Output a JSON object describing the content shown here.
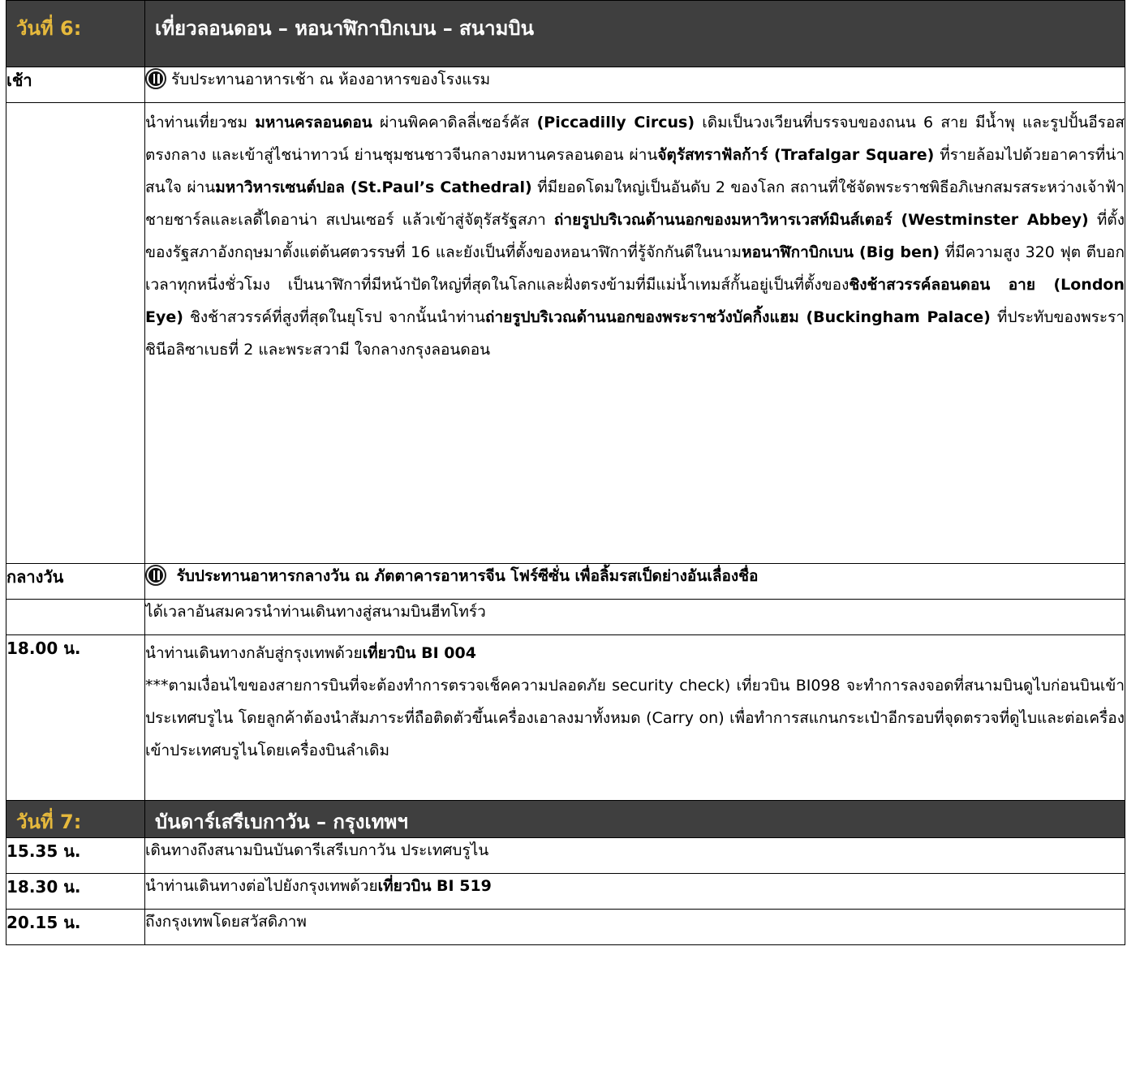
{
  "day6": {
    "label": "วันที่ 6:",
    "title": "เที่ยวลอนดอน – หอนาฬิกาบิกเบน – สนามบิน",
    "breakfast_label": "เช้า",
    "breakfast_text": "รับประทานอาหารเช้า ณ ห้องอาหารของโรงแรม",
    "tour": {
      "p1": "นำท่านเที่ยวชม ",
      "b1": "มหานครลอนดอน",
      "p2": " ผ่านพิคคาดิลลี่เซอร์คัส ",
      "b2": "(Piccadilly Circus)",
      "p3": " เดิมเป็นวงเวียนที่บรรจบของถนน 6 สาย มีน้ำพุ และรูปปั้นอีรอสตรงกลาง และเข้าสู่ไชน่าทาวน์ ย่านชุมชนชาวจีนกลางมหานครลอนดอน ผ่าน",
      "b3": "จัตุรัสทราฟัลก้าร์ (Trafalgar Square)",
      "p4": " ที่รายล้อมไปด้วยอาคารที่น่าสนใจ ผ่าน",
      "b4": "มหาวิหารเซนต์ปอล (St.Paul’s Cathedral)",
      "p5": " ที่มียอดโดมใหญ่เป็นอันดับ 2 ของโลก สถานที่ใช้จัดพระราชพิธีอภิเษกสมรสระหว่างเจ้าฟ้าชายชาร์ลและเลดี้ไดอาน่า สเปนเซอร์ แล้วเข้าสู่จัตุรัสรัฐสภา ",
      "b5": "ถ่ายรูปบริเวณด้านนอกของมหาวิหารเวสท์มินส์เตอร์ (Westminster Abbey)",
      "p6": " ที่ตั้งของรัฐสภาอังกฤษมาตั้งแต่ต้นศตวรรษที่ 16 และยังเป็นที่ตั้งของหอนาฬิกาที่รู้จักกันดีในนาม",
      "b6": "หอนาฬิกาบิกเบน (Big ben)",
      "p7": " ที่มีความสูง 320 ฟุต ตีบอกเวลาทุกหนึ่งชั่วโมง เป็นนาฬิกาที่มีหน้าปัดใหญ่ที่สุดในโลกและฝั่งตรงข้ามที่มีแม่น้ำเทมส์กั้นอยู่เป็นที่ตั้งของ",
      "b7": "ชิงช้าสวรรค์ลอนดอน อาย (London Eye)",
      "p8": " ชิงช้าสวรรค์ที่สูงที่สุดในยุโรป  จากนั้นนำท่าน",
      "b8": "ถ่ายรูปบริเวณด้านนอกของพระราชวังบัคกิ้งแฮม (Buckingham Palace)",
      "p9": " ที่ประทับของพระราชินีอลิซาเบธที่ 2 และพระสวามี ใจกลางกรุงลอนดอน"
    },
    "lunch_label": "กลางวัน",
    "lunch_text": "รับประทานอาหารกลางวัน ณ ภัตตาคารอาหารจีน โฟร์ซีซั่น เพื่อลิ้มรสเป็ดย่างอันเลื่องชื่อ",
    "airport_text": "ได้เวลาอันสมควรนำท่านเดินทางสู่สนามบินฮีทโทร์ว",
    "flight_time": "18.00 น.",
    "flight_pre": "นำท่านเดินทางกลับสู่กรุงเทพด้วย",
    "flight_bold": "เที่ยวบิน BI 004",
    "flight_note": "***ตามเงื่อนไขของสายการบินที่จะต้องทำการตรวจเช็คความปลอดภัย security check) เที่ยวบิน BI098 จะทำการลงจอดที่สนามบินดูไบก่อนบินเข้าประเทศบรูไน โดยลูกค้าต้องนำสัมภาระที่ถือติดตัวขึ้นเครื่องเอาลงมาทั้งหมด (Carry on) เพื่อทำการสแกนกระเป๋าอีกรอบที่จุดตรวจที่ดูไบและต่อเครื่องเข้าประเทศบรูไนโดยเครื่องบินลำเดิม"
  },
  "day7": {
    "label": "วันที่ 7:",
    "title": "บันดาร์เสรีเบกาวัน – กรุงเทพฯ",
    "rows": [
      {
        "time": "15.35 น.",
        "text": "เดินทางถึงสนามบินบันดารีเสรีเบกาวัน ประเทศบรูไน",
        "bold": ""
      },
      {
        "time": "18.30 น.",
        "text": "นำท่านเดินทางต่อไปยังกรุงเทพด้วย",
        "bold": "เที่ยวบิน BI 519"
      },
      {
        "time": "20.15 น.",
        "text": "ถึงกรุงเทพโดยสวัสดิภาพ",
        "bold": ""
      }
    ]
  },
  "icons": {
    "meal": "fork-knife-icon"
  },
  "colors": {
    "header_bg": "#3f3f3f",
    "day_label": "#e6b93c"
  }
}
